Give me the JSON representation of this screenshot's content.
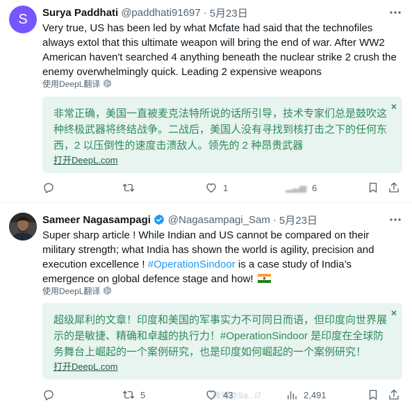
{
  "tweets": [
    {
      "avatar_letter": "S",
      "name": "Surya Paddhati",
      "handle": "@paddhati91697",
      "separator": "·",
      "time": "5月23日",
      "text": "Very true, US has been led by what Mcfate had said that the technofiles always extol that this ultimate weapon will bring the end of war. After WW2 American haven't searched 4 anything beneath the nuclear strike 2 crush the enemy overwhelmingly quick. Leading 2 expensive weapons",
      "translate_label": "使用DeepL翻译",
      "translation": "非常正确，美国一直被麦克法特所说的话所引导，技术专家们总是鼓吹这种终极武器将终结战争。二战后，美国人没有寻找到核打击之下的任何东西，2 以压倒性的速度击溃敌人。领先的 2 种昂贵武器",
      "open_deepl": "打开DeepL.com",
      "close_symbol": "×",
      "actions": {
        "reply": "",
        "retweet": "",
        "like": "1",
        "views": "6"
      }
    },
    {
      "name": "Sameer Nagasampagi",
      "handle": "@Nagasampagi_Sam",
      "separator": "·",
      "time": "5月23日",
      "text_before_hashtag": "Super sharp article ! While Indian and US cannot be compared on their military strength; what India has shown the world is agility, precision and execution excellence ! ",
      "hashtag": "#OperationSindoor",
      "text_after_hashtag": " is a case study of India’s emergence on global defence stage and how! ",
      "translate_label": "使用DeepL翻译",
      "translation": "超级犀利的文章！印度和美国的军事实力不可同日而语，但印度向世界展示的是敏捷、精确和卓越的执行力！#OperationSindoor 是印度在全球防务舞台上崛起的一个案例研究，也是印度如何崛起的一个案例研究！",
      "open_deepl": "打开DeepL.com",
      "close_symbol": "×",
      "actions": {
        "reply": "",
        "retweet": "5",
        "like": "43",
        "views": "2,491"
      },
      "watermark": "微博@Sa...i7"
    }
  ],
  "colors": {
    "accent": "#1d9bf0",
    "translation_bg": "#e8f4f0",
    "translation_text": "#2e8a5a",
    "secondary_text": "#536471",
    "avatar_bg": "#7856ff"
  },
  "icons": [
    "more-icon",
    "verified-icon",
    "deepl-icon",
    "reply-icon",
    "retweet-icon",
    "like-icon",
    "views-icon",
    "bookmark-icon",
    "share-icon",
    "close-icon",
    "india-flag-icon"
  ]
}
